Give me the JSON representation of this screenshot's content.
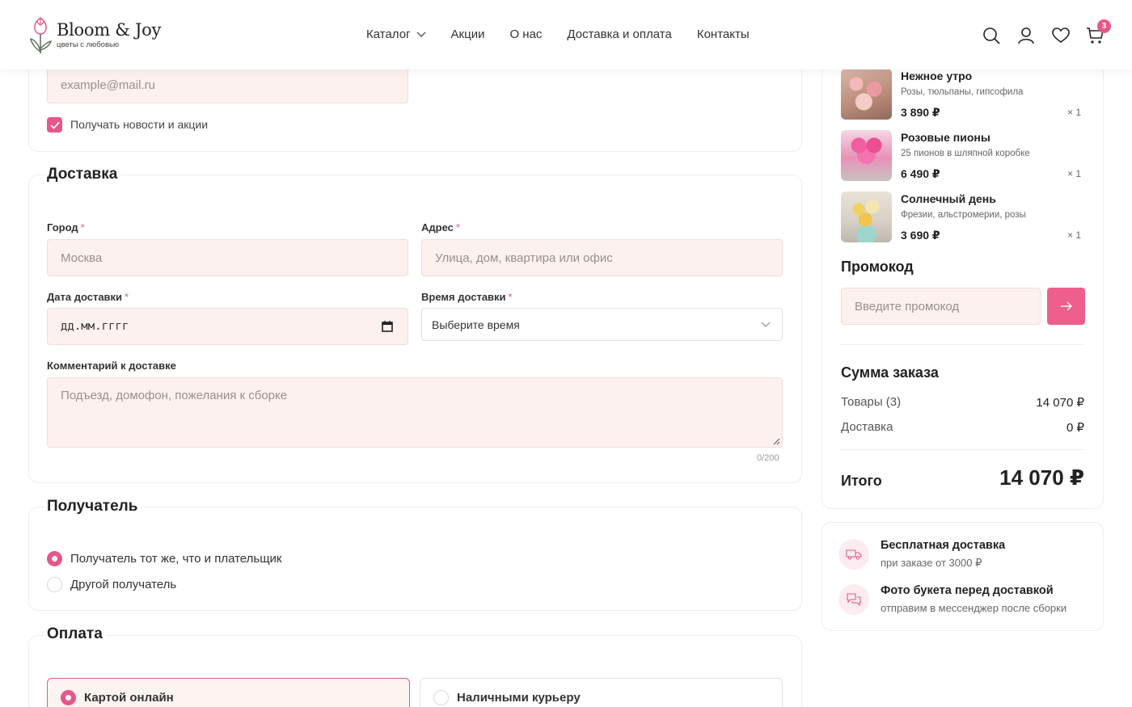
{
  "brand": {
    "title": "Bloom & Joy",
    "subtitle": "цветы с любовью"
  },
  "nav": {
    "items": [
      "Каталог",
      "Акции",
      "О нас",
      "Доставка и оплата",
      "Контакты"
    ]
  },
  "header_icons": {
    "search": "search-icon",
    "account": "user-icon",
    "favorites": "heart-icon",
    "cart": "cart-icon",
    "cart_count": "3"
  },
  "contact": {
    "email_placeholder": "example@mail.ru",
    "newsletter_label": "Получать новости и акции",
    "newsletter_checked": true
  },
  "delivery": {
    "title": "Доставка",
    "city_label": "Город",
    "city_placeholder": "Москва",
    "address_label": "Адрес",
    "address_placeholder": "Улица, дом, квартира или офис",
    "date_label": "Дата доставки",
    "date_placeholder": "дд.мм.гггг",
    "time_label": "Время доставки",
    "time_value": "Выберите время",
    "comment_label": "Комментарий к доставке",
    "comment_placeholder": "Подъезд, домофон, пожелания к сборке",
    "comment_counter": "0/200",
    "required_mark": "*"
  },
  "recipient": {
    "title": "Получатель",
    "options": [
      {
        "label": "Получатель тот же, что и плательщик",
        "selected": true
      },
      {
        "label": "Другой получатель",
        "selected": false
      }
    ]
  },
  "payment": {
    "title": "Оплата",
    "options": [
      {
        "label": "Картой онлайн",
        "selected": true
      },
      {
        "label": "Наличными курьеру",
        "selected": false
      }
    ]
  },
  "cart": {
    "items": [
      {
        "name": "Нежное утро",
        "desc": "Розы, тюльпаны, гипсофила",
        "price": "3 890 ₽",
        "qty": "× 1"
      },
      {
        "name": "Розовые пионы",
        "desc": "25 пионов в шляпной коробке",
        "price": "6 490 ₽",
        "qty": "× 1"
      },
      {
        "name": "Солнечный день",
        "desc": "Фрезии, альстромерии, розы",
        "price": "3 690 ₽",
        "qty": "× 1"
      }
    ]
  },
  "promo": {
    "title": "Промокод",
    "placeholder": "Введите промокод",
    "button_icon": "arrow-right-icon"
  },
  "summary": {
    "title": "Сумма заказа",
    "goods_label": "Товары (3)",
    "goods_value": "14 070 ₽",
    "delivery_label": "Доставка",
    "delivery_value": "0 ₽",
    "total_label": "Итого",
    "total_value": "14 070 ₽"
  },
  "features": [
    {
      "title": "Бесплатная доставка",
      "sub": "при заказе от 3000 ₽",
      "icon": "truck-icon"
    },
    {
      "title": "Фото букета перед доставкой",
      "sub": "отправим в мессенджер после сборки",
      "icon": "chat-icon"
    }
  ],
  "colors": {
    "accent": "#e5578a",
    "input_bg": "#fcf1ef",
    "border": "#f0ecec"
  }
}
